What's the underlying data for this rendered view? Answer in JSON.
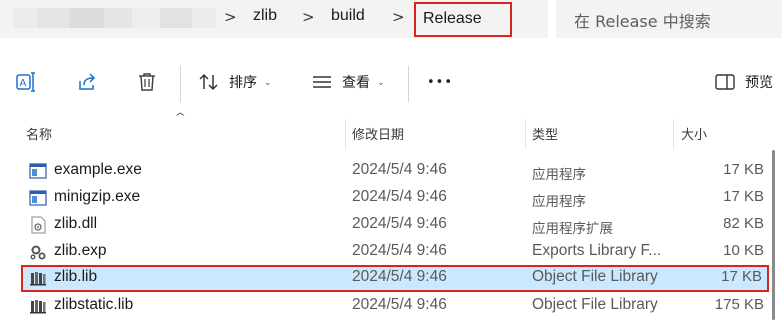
{
  "address": {
    "crumbs": [
      "zlib",
      "build"
    ],
    "current": "Release",
    "separator": ">"
  },
  "search": {
    "placeholder": "在 Release 中搜索"
  },
  "toolbar": {
    "sort_label": "排序",
    "view_label": "查看",
    "more_label": "•••",
    "preview_label": "预览",
    "dropdown_glyph": "⌄"
  },
  "columns": {
    "name": "名称",
    "date": "修改日期",
    "type": "类型",
    "size": "大小"
  },
  "files": [
    {
      "name": "example.exe",
      "date": "2024/5/4 9:46",
      "type": "应用程序",
      "size": "17 KB",
      "icon": "exe-icon",
      "selected": false
    },
    {
      "name": "minigzip.exe",
      "date": "2024/5/4 9:46",
      "type": "应用程序",
      "size": "17 KB",
      "icon": "exe-icon",
      "selected": false
    },
    {
      "name": "zlib.dll",
      "date": "2024/5/4 9:46",
      "type": "应用程序扩展",
      "size": "82 KB",
      "icon": "dll-icon",
      "selected": false
    },
    {
      "name": "zlib.exp",
      "date": "2024/5/4 9:46",
      "type": "Exports Library F...",
      "size": "10 KB",
      "icon": "exp-icon",
      "selected": false
    },
    {
      "name": "zlib.lib",
      "date": "2024/5/4 9:46",
      "type": "Object File Library",
      "size": "17 KB",
      "icon": "lib-icon",
      "selected": true
    },
    {
      "name": "zlibstatic.lib",
      "date": "2024/5/4 9:46",
      "type": "Object File Library",
      "size": "175 KB",
      "icon": "lib-icon",
      "selected": false
    }
  ],
  "colors": {
    "selection_bg": "#cce8ff",
    "highlight_border": "#d9251d",
    "accent": "#1a73c8"
  }
}
